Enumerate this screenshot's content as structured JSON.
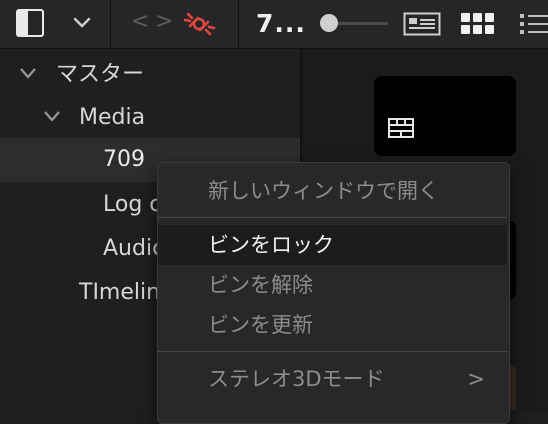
{
  "toolbar": {
    "nav_back": "<",
    "nav_forward": ">",
    "title": "7...",
    "zoom_slider_level": 0.1
  },
  "tree": {
    "items": [
      {
        "label": "マスター",
        "expanded": true
      },
      {
        "label": "Media",
        "expanded": true
      },
      {
        "label": "709",
        "selected": true
      },
      {
        "label": "Log c"
      },
      {
        "label": "Audic"
      },
      {
        "label": "TImelin"
      }
    ]
  },
  "context_menu": {
    "items": [
      {
        "label": "新しいウィンドウで開く",
        "enabled": false
      },
      {
        "label": "ビンをロック",
        "enabled": true,
        "highlighted": true
      },
      {
        "label": "ビンを解除",
        "enabled": false
      },
      {
        "label": "ビンを更新",
        "enabled": false
      },
      {
        "label": "ステレオ3Dモード",
        "enabled": false,
        "submenu": true
      }
    ],
    "submenu_arrow": ">"
  },
  "colors": {
    "accent_link": "#e2463c",
    "background": "#1e1e1f",
    "menu_bg": "#28282a"
  },
  "icons": [
    "sidebar-toggle-icon",
    "chevron-down-icon",
    "unlink-icon",
    "viewer-icon",
    "grid-view-icon",
    "list-view-icon",
    "clip-icon"
  ]
}
